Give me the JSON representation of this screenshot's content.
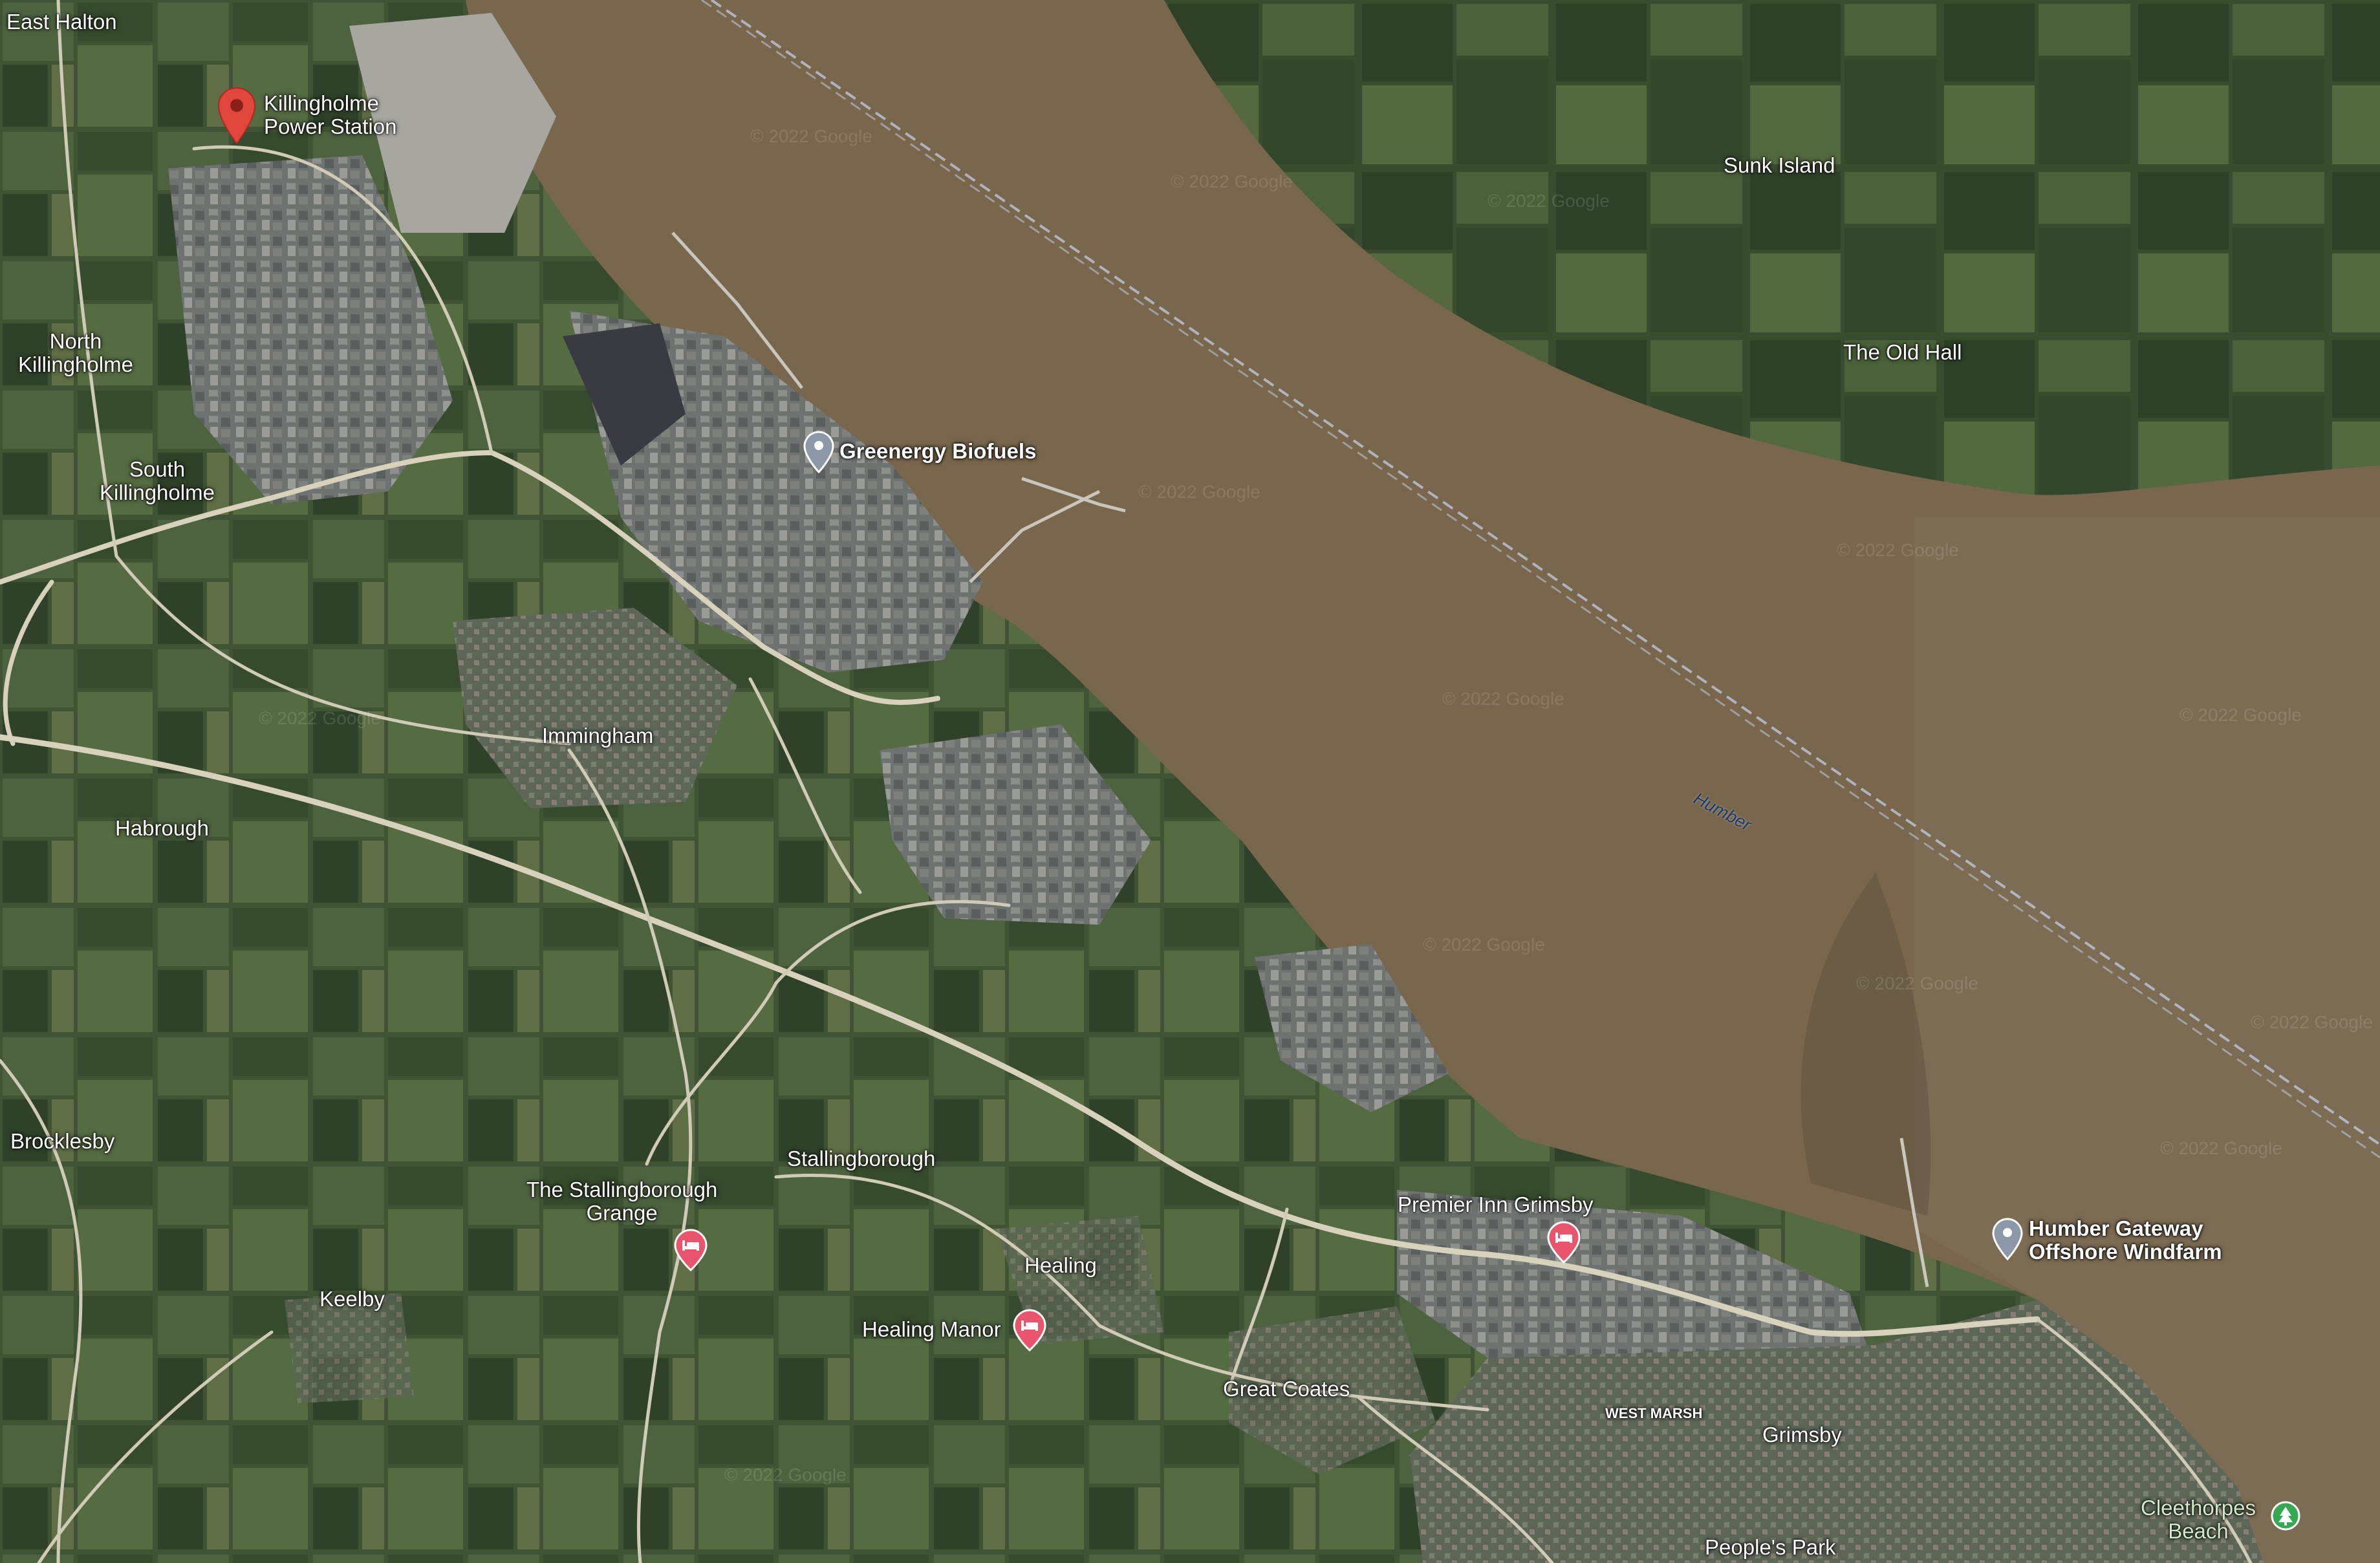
{
  "map": {
    "type": "satellite",
    "watermark": "© 2022 Google",
    "water_label": "Humber",
    "colors": {
      "estuary": "#77654c",
      "farmland": "#3f5233",
      "urban": "#7a7a78",
      "road": "#d8d2bc",
      "red_pin": "#e0463c",
      "hotel_pin": "#e8556d",
      "grey_pin": "#8c98a8"
    }
  },
  "places": [
    {
      "id": "east-halton",
      "label": "East Halton"
    },
    {
      "id": "north-killingholme",
      "line1": "North",
      "line2": "Killingholme"
    },
    {
      "id": "south-killingholme",
      "line1": "South",
      "line2": "Killingholme"
    },
    {
      "id": "immingham",
      "label": "Immingham"
    },
    {
      "id": "habrough",
      "label": "Habrough"
    },
    {
      "id": "brocklesby",
      "label": "Brocklesby"
    },
    {
      "id": "keelby",
      "label": "Keelby"
    },
    {
      "id": "stallingborough",
      "label": "Stallingborough"
    },
    {
      "id": "healing",
      "label": "Healing"
    },
    {
      "id": "great-coates",
      "label": "Great Coates"
    },
    {
      "id": "grimsby",
      "label": "Grimsby"
    },
    {
      "id": "west-marsh",
      "label": "WEST MARSH"
    },
    {
      "id": "peoples-park",
      "label": "People's Park"
    },
    {
      "id": "sunk-island",
      "label": "Sunk Island"
    },
    {
      "id": "the-old-hall",
      "label": "The Old Hall"
    }
  ],
  "pois": {
    "killingholme": {
      "line1": "Killingholme",
      "line2": "Power Station",
      "icon": "red-location-pin-icon"
    },
    "greenergy": {
      "label": "Greenergy Biofuels",
      "icon": "grey-location-pin-icon"
    },
    "humber_gateway": {
      "line1": "Humber Gateway",
      "line2": "Offshore Windfarm",
      "icon": "grey-location-pin-icon"
    },
    "premier_inn": {
      "label": "Premier Inn Grimsby",
      "icon": "hotel-bed-icon"
    },
    "stallingborough_grange": {
      "line1": "The Stallingborough",
      "line2": "Grange",
      "icon": "hotel-bed-icon"
    },
    "healing_manor": {
      "label": "Healing Manor",
      "icon": "hotel-bed-icon"
    },
    "cleethorpes_beach": {
      "line1": "Cleethorpes",
      "line2": "Beach",
      "icon": "park-icon"
    }
  }
}
